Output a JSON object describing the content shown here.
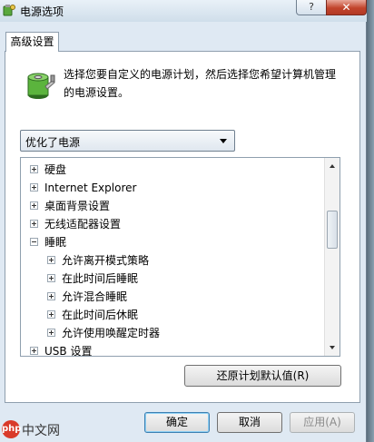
{
  "window": {
    "title": "电源选项",
    "help_label": "?",
    "close_label": "✕"
  },
  "tab": {
    "label": "高级设置"
  },
  "description": "选择您要自定义的电源计划，然后选择您希望计算机管理的电源设置。",
  "plan_select": {
    "value": "优化了电源"
  },
  "tree": [
    {
      "label": "硬盘",
      "level": 0,
      "expander": "plus"
    },
    {
      "label": "Internet Explorer",
      "level": 0,
      "expander": "plus"
    },
    {
      "label": "桌面背景设置",
      "level": 0,
      "expander": "plus"
    },
    {
      "label": "无线适配器设置",
      "level": 0,
      "expander": "plus"
    },
    {
      "label": "睡眠",
      "level": 0,
      "expander": "minus"
    },
    {
      "label": "允许离开模式策略",
      "level": 1,
      "expander": "plus"
    },
    {
      "label": "在此时间后睡眠",
      "level": 1,
      "expander": "plus"
    },
    {
      "label": "允许混合睡眠",
      "level": 1,
      "expander": "plus"
    },
    {
      "label": "在此时间后休眠",
      "level": 1,
      "expander": "plus"
    },
    {
      "label": "允许使用唤醒定时器",
      "level": 1,
      "expander": "plus"
    },
    {
      "label": "USB 设置",
      "level": 0,
      "expander": "plus"
    }
  ],
  "buttons": {
    "restore": "还原计划默认值(R)",
    "ok": "确定",
    "cancel": "取消",
    "apply": "应用(A)"
  },
  "watermark": {
    "logo": "php",
    "text": "中文网"
  }
}
